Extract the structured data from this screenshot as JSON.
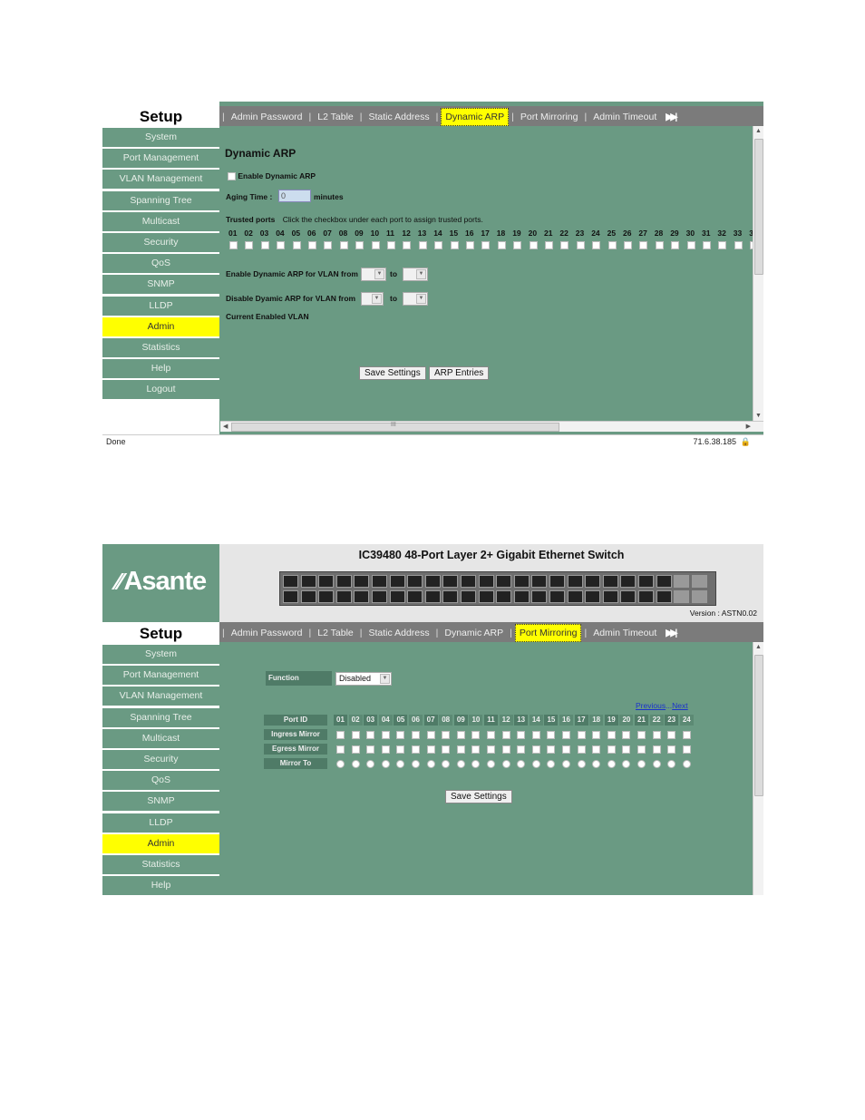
{
  "sidebar": {
    "title": "Setup",
    "items": [
      "System",
      "Port Management",
      "VLAN Management",
      "Spanning Tree",
      "Multicast",
      "Security",
      "QoS",
      "SNMP",
      "LLDP",
      "Admin",
      "Statistics",
      "Help",
      "Logout"
    ]
  },
  "tabs": {
    "items": [
      "Admin Password",
      "L2 Table",
      "Static Address",
      "Dynamic ARP",
      "Port Mirroring",
      "Admin Timeout"
    ],
    "separator": "|",
    "next_icon": "▶▶|"
  },
  "screen1": {
    "active_tab": "Dynamic ARP",
    "active_nav": "Admin",
    "heading": "Dynamic ARP",
    "enable_label": "Enable Dynamic ARP",
    "aging_label": "Aging Time :",
    "aging_value": "0",
    "aging_unit": "minutes",
    "trusted_label": "Trusted ports",
    "trusted_hint": "Click the checkbox under each port to assign trusted ports.",
    "ports": [
      "01",
      "02",
      "03",
      "04",
      "05",
      "06",
      "07",
      "08",
      "09",
      "10",
      "11",
      "12",
      "13",
      "14",
      "15",
      "16",
      "17",
      "18",
      "19",
      "20",
      "21",
      "22",
      "23",
      "24",
      "25",
      "26",
      "27",
      "28",
      "29",
      "30",
      "31",
      "32",
      "33",
      "3"
    ],
    "enable_vlan_label": "Enable Dynamic ARP for VLAN from",
    "disable_vlan_label": "Disable Dyamic ARP for VLAN from",
    "to_label": "to",
    "current_vlan_label": "Current Enabled VLAN",
    "save_button": "Save Settings",
    "arp_button": "ARP Entries",
    "status_left": "Done",
    "status_ip": "71.6.38.185",
    "hscroll_mark": "III"
  },
  "screen2": {
    "active_tab": "Port Mirroring",
    "active_nav": "Admin",
    "logo_text": "Asante",
    "switch_title": "IC39480 48-Port Layer 2+ Gigabit Ethernet Switch",
    "version_label": "Version :",
    "version_value": "ASTN0.02",
    "function_label": "Function",
    "function_value": "Disabled",
    "prev_link": "Previous",
    "dots": "...",
    "next_link": "Next",
    "port_id_label": "Port ID",
    "ports": [
      "01",
      "02",
      "03",
      "04",
      "05",
      "06",
      "07",
      "08",
      "09",
      "10",
      "11",
      "12",
      "13",
      "14",
      "15",
      "16",
      "17",
      "18",
      "19",
      "20",
      "21",
      "22",
      "23",
      "24"
    ],
    "row_labels": [
      "Ingress Mirror",
      "Egress Mirror",
      "Mirror To"
    ],
    "save_button": "Save Settings"
  },
  "colors": {
    "background_green": "#6a9a83",
    "highlight_yellow": "#ffff00",
    "tabbar_gray": "#7b7b7b"
  }
}
